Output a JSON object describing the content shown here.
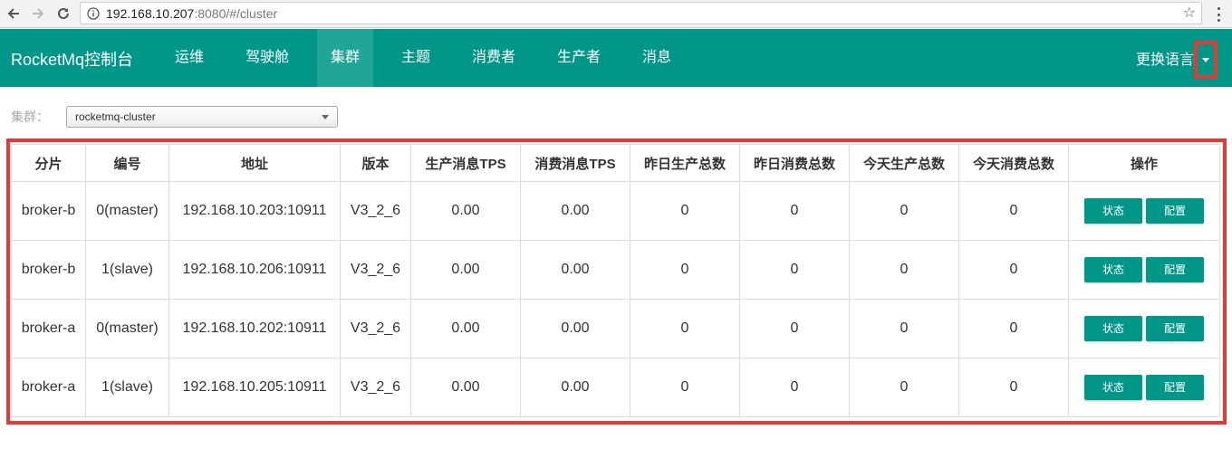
{
  "browser": {
    "url_host": "192.168.10.207",
    "url_rest": ":8080/#/cluster"
  },
  "navbar": {
    "brand": "RocketMq控制台",
    "items": [
      "运维",
      "驾驶舱",
      "集群",
      "主题",
      "消费者",
      "生产者",
      "消息"
    ],
    "active_index": 2,
    "language_label": "更换语言"
  },
  "cluster": {
    "label": "集群：",
    "selected": "rocketmq-cluster"
  },
  "table": {
    "headers": [
      "分片",
      "编号",
      "地址",
      "版本",
      "生产消息TPS",
      "消费消息TPS",
      "昨日生产总数",
      "昨日消费总数",
      "今天生产总数",
      "今天消费总数",
      "操作"
    ],
    "rows": [
      {
        "broker": "broker-b",
        "id": "0(master)",
        "address": "192.168.10.203:10911",
        "version": "V3_2_6",
        "produce_tps": "0.00",
        "consume_tps": "0.00",
        "yesterday_produce": "0",
        "yesterday_consume": "0",
        "today_produce": "0",
        "today_consume": "0"
      },
      {
        "broker": "broker-b",
        "id": "1(slave)",
        "address": "192.168.10.206:10911",
        "version": "V3_2_6",
        "produce_tps": "0.00",
        "consume_tps": "0.00",
        "yesterday_produce": "0",
        "yesterday_consume": "0",
        "today_produce": "0",
        "today_consume": "0"
      },
      {
        "broker": "broker-a",
        "id": "0(master)",
        "address": "192.168.10.202:10911",
        "version": "V3_2_6",
        "produce_tps": "0.00",
        "consume_tps": "0.00",
        "yesterday_produce": "0",
        "yesterday_consume": "0",
        "today_produce": "0",
        "today_consume": "0"
      },
      {
        "broker": "broker-a",
        "id": "1(slave)",
        "address": "192.168.10.205:10911",
        "version": "V3_2_6",
        "produce_tps": "0.00",
        "consume_tps": "0.00",
        "yesterday_produce": "0",
        "yesterday_consume": "0",
        "today_produce": "0",
        "today_consume": "0"
      }
    ],
    "status_button": "状态",
    "config_button": "配置"
  },
  "colors": {
    "navbar_bg": "#009688",
    "navbar_active": "#1fa697",
    "button_bg": "#009688",
    "highlight_border": "#e53935"
  },
  "icons": {
    "back": "arrow-left-icon",
    "forward": "arrow-right-icon",
    "reload": "reload-icon",
    "info": "info-icon",
    "bookmark": "star-icon",
    "menu": "kebab-menu-icon",
    "language_dropdown": "caret-down-icon"
  }
}
